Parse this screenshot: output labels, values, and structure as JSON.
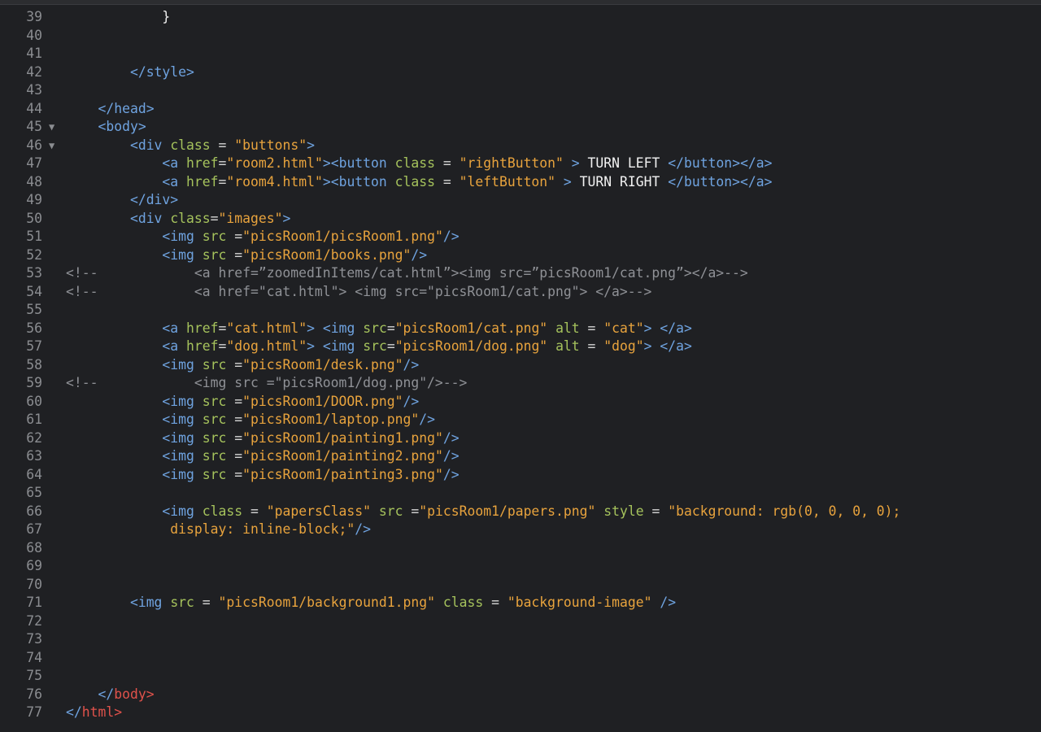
{
  "editor": {
    "lines": [
      {
        "num": "39",
        "fold": "",
        "code": "            }"
      },
      {
        "num": "40",
        "fold": "",
        "code": ""
      },
      {
        "num": "41",
        "fold": "",
        "code": ""
      },
      {
        "num": "42",
        "fold": "",
        "code": "        </style>"
      },
      {
        "num": "43",
        "fold": "",
        "code": ""
      },
      {
        "num": "44",
        "fold": "",
        "code": "    </head>"
      },
      {
        "num": "45",
        "fold": "▼",
        "code": "    <body>"
      },
      {
        "num": "46",
        "fold": "▼",
        "code": "        <div class = \"buttons\">"
      },
      {
        "num": "47",
        "fold": "",
        "code": "            <a href=\"room2.html\"><button class = \"rightButton\" > TURN LEFT </button></a>"
      },
      {
        "num": "48",
        "fold": "",
        "code": "            <a href=\"room4.html\"><button class = \"leftButton\" > TURN RIGHT </button></a>"
      },
      {
        "num": "49",
        "fold": "",
        "code": "        </div>"
      },
      {
        "num": "50",
        "fold": "",
        "code": "        <div class=\"images\">"
      },
      {
        "num": "51",
        "fold": "",
        "code": "            <img src =\"picsRoom1/picsRoom1.png\"/>"
      },
      {
        "num": "52",
        "fold": "",
        "code": "            <img src =\"picsRoom1/books.png\"/>"
      },
      {
        "num": "53",
        "fold": "",
        "code": "<!--            <a href=”zoomedInItems/cat.html”><img src=”picsRoom1/cat.png”></a>-->"
      },
      {
        "num": "54",
        "fold": "",
        "code": "<!--            <a href=\"cat.html\"> <img src=\"picsRoom1/cat.png\"> </a>-->"
      },
      {
        "num": "55",
        "fold": "",
        "code": ""
      },
      {
        "num": "56",
        "fold": "",
        "code": "            <a href=\"cat.html\"> <img src=\"picsRoom1/cat.png\" alt = \"cat\"> </a>"
      },
      {
        "num": "57",
        "fold": "",
        "code": "            <a href=\"dog.html\"> <img src=\"picsRoom1/dog.png\" alt = \"dog\"> </a>"
      },
      {
        "num": "58",
        "fold": "",
        "code": "            <img src =\"picsRoom1/desk.png\"/>"
      },
      {
        "num": "59",
        "fold": "",
        "code": "<!--            <img src =\"picsRoom1/dog.png\"/>-->"
      },
      {
        "num": "60",
        "fold": "",
        "code": "            <img src =\"picsRoom1/DOOR.png\"/>"
      },
      {
        "num": "61",
        "fold": "",
        "code": "            <img src =\"picsRoom1/laptop.png\"/>"
      },
      {
        "num": "62",
        "fold": "",
        "code": "            <img src =\"picsRoom1/painting1.png\"/>"
      },
      {
        "num": "63",
        "fold": "",
        "code": "            <img src =\"picsRoom1/painting2.png\"/>"
      },
      {
        "num": "64",
        "fold": "",
        "code": "            <img src =\"picsRoom1/painting3.png\"/>"
      },
      {
        "num": "65",
        "fold": "",
        "code": ""
      },
      {
        "num": "66",
        "fold": "",
        "code": "            <img class = \"papersClass\" src =\"picsRoom1/papers.png\" style = \"background: rgb(0, 0, 0, 0);"
      },
      {
        "num": "67",
        "fold": "",
        "code": "             display: inline-block;\"/>"
      },
      {
        "num": "68",
        "fold": "",
        "code": ""
      },
      {
        "num": "69",
        "fold": "",
        "code": ""
      },
      {
        "num": "70",
        "fold": "",
        "code": ""
      },
      {
        "num": "71",
        "fold": "",
        "code": "        <img src = \"picsRoom1/background1.png\" class = \"background-image\" />"
      },
      {
        "num": "72",
        "fold": "",
        "code": ""
      },
      {
        "num": "73",
        "fold": "",
        "code": ""
      },
      {
        "num": "74",
        "fold": "",
        "code": ""
      },
      {
        "num": "75",
        "fold": "",
        "code": ""
      },
      {
        "num": "76",
        "fold": "",
        "code": "    </body>"
      },
      {
        "num": "77",
        "fold": "",
        "code": "</html>"
      }
    ]
  },
  "colors": {
    "background": "#1f2023",
    "line_number": "#8b8d91",
    "tag": "#6fa3e0",
    "attribute": "#a5c25c",
    "string": "#e8a33d",
    "text": "#f2f2f2",
    "comment": "#8f9196",
    "closing_root_tag": "#e0524b"
  }
}
